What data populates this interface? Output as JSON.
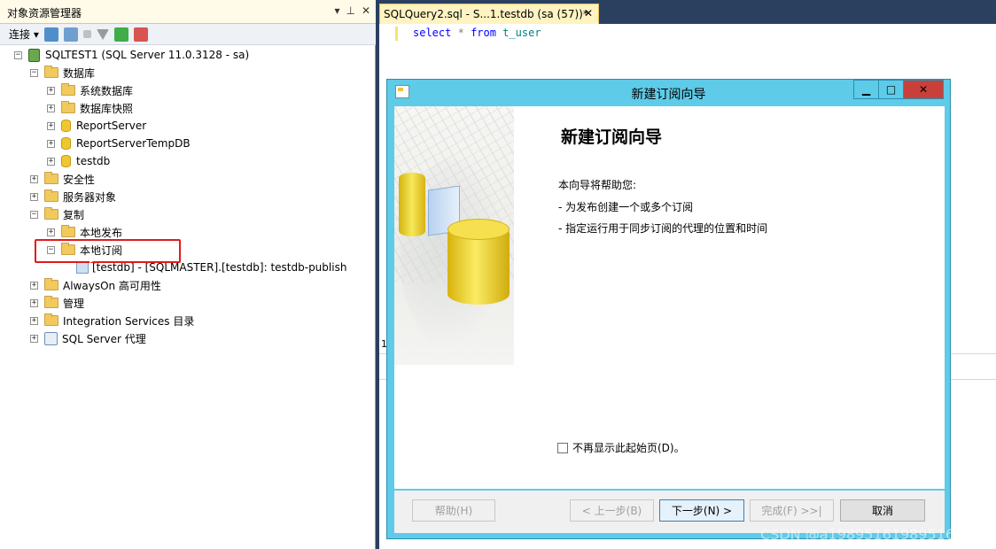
{
  "explorer": {
    "title": "对象资源管理器",
    "title_buttons": [
      "▾",
      "⊥",
      "✕"
    ],
    "toolbar": {
      "connect_label": "连接"
    },
    "tree": {
      "server": "SQLTEST1 (SQL Server 11.0.3128 - sa)",
      "databases": "数据库",
      "system_databases": "系统数据库",
      "db_snapshots": "数据库快照",
      "db_reportserver": "ReportServer",
      "db_reportservertempdb": "ReportServerTempDB",
      "db_testdb": "testdb",
      "security": "安全性",
      "server_objects": "服务器对象",
      "replication": "复制",
      "local_publications": "本地发布",
      "local_subscriptions": "本地订阅",
      "publication_item": "[testdb] - [SQLMASTER].[testdb]: testdb-publish",
      "alwayson": "AlwaysOn 高可用性",
      "management": "管理",
      "integration_services": "Integration Services 目录",
      "sql_agent": "SQL Server 代理"
    }
  },
  "query": {
    "tab_label": "SQLQuery2.sql - S...1.testdb (sa (57))*",
    "code": {
      "kw1": "select",
      "op": "*",
      "kw2": "from",
      "table": "t_user"
    },
    "line_number": "1"
  },
  "dialog": {
    "title": "新建订阅向导",
    "heading": "新建订阅向导",
    "intro": "本向导将帮助您:",
    "bullets": [
      "- 为发布创建一个或多个订阅",
      "- 指定运行用于同步订阅的代理的位置和时间"
    ],
    "checkbox_label": "不再显示此起始页(D)。",
    "checkbox_checked": false,
    "buttons": {
      "help": "帮助(H)",
      "back": "< 上一步(B)",
      "next": "下一步(N) >",
      "finish": "完成(F) >>|",
      "cancel": "取消"
    }
  },
  "watermark": "CSDN @a19895161989516"
}
